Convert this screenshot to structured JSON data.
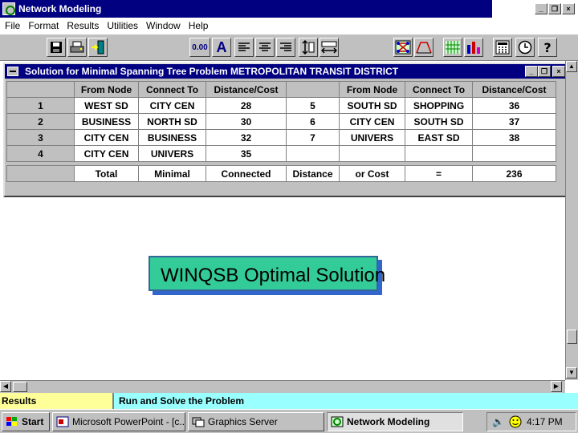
{
  "app": {
    "title": "Network Modeling"
  },
  "window_controls": {
    "minimize": "_",
    "restore": "❐",
    "close": "×"
  },
  "menu": [
    "File",
    "Format",
    "Results",
    "Utilities",
    "Window",
    "Help"
  ],
  "toolbar": {
    "decimal_label": "0.00",
    "font_label": "A"
  },
  "child_window": {
    "title": "Solution for Minimal Spanning Tree Problem METROPOLITAN TRANSIT DISTRICT"
  },
  "grid": {
    "headers": [
      "From Node",
      "Connect To",
      "Distance/Cost",
      "",
      "From Node",
      "Connect To",
      "Distance/Cost"
    ],
    "rows": [
      {
        "num": "1",
        "cells": [
          "WEST SD",
          "CITY CEN",
          "28",
          "5",
          "SOUTH SD",
          "SHOPPING",
          "36"
        ]
      },
      {
        "num": "2",
        "cells": [
          "BUSINESS",
          "NORTH SD",
          "30",
          "6",
          "CITY CEN",
          "SOUTH SD",
          "37"
        ]
      },
      {
        "num": "3",
        "cells": [
          "CITY CEN",
          "BUSINESS",
          "32",
          "7",
          "UNIVERS",
          "EAST SD",
          "38"
        ]
      },
      {
        "num": "4",
        "cells": [
          "CITY CEN",
          "UNIVERS",
          "35",
          "",
          "",
          "",
          ""
        ]
      }
    ],
    "total_row": [
      "Total",
      "Minimal",
      "Connected",
      "Distance",
      "or Cost",
      "=",
      "236"
    ]
  },
  "status": {
    "left": "Results",
    "right": "Run and Solve the Problem"
  },
  "overlay_label": "WINQSB Optimal Solution",
  "taskbar": {
    "start": "Start",
    "buttons": [
      "Microsoft PowerPoint - [c...",
      "Graphics Server",
      "Network Modeling"
    ],
    "clock": "4:17 PM"
  },
  "colors": {
    "title_bar": "#000080",
    "status_left": "#ffff99",
    "status_right": "#99ffff",
    "overlay_box": "#33cc99",
    "overlay_shadow": "#3366cc"
  }
}
